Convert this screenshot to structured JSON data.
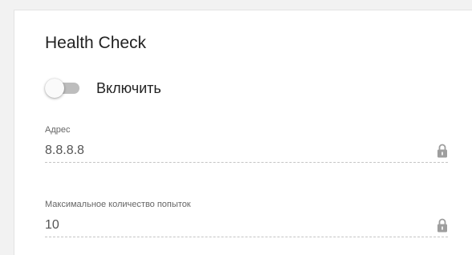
{
  "section": {
    "title": "Health Check"
  },
  "enable_toggle": {
    "label": "Включить",
    "state": "off"
  },
  "address_field": {
    "label": "Адрес",
    "value": "8.8.8.8",
    "icon": "lock-icon"
  },
  "max_attempts_field": {
    "label": "Максимальное количество попыток",
    "value": "10",
    "icon": "lock-icon"
  },
  "colors": {
    "toggle_track_off": "#bdbdbd",
    "toggle_thumb": "#fafafa",
    "lock_icon": "#9e9e9e"
  }
}
